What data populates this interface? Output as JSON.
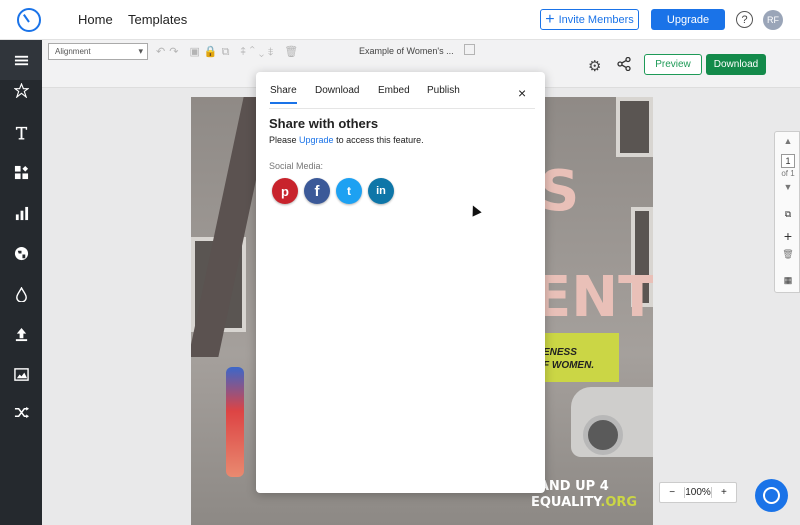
{
  "header": {
    "nav": [
      "Home",
      "Templates"
    ],
    "invite_label": "Invite Members",
    "upgrade_label": "Upgrade",
    "help": "?",
    "avatar_initials": "RF"
  },
  "sidebar": {
    "items": [
      {
        "icon": "menu-icon"
      },
      {
        "icon": "star-icon"
      },
      {
        "icon": "text-icon"
      },
      {
        "icon": "shapes-icon"
      },
      {
        "icon": "chart-icon"
      },
      {
        "icon": "globe-icon"
      },
      {
        "icon": "droplet-icon"
      },
      {
        "icon": "upload-icon"
      },
      {
        "icon": "image-icon"
      },
      {
        "icon": "shuffle-icon"
      }
    ]
  },
  "toolbar": {
    "alignment_select": "Alignment",
    "document_title": "Example of Women's ...",
    "preview_label": "Preview",
    "download_label": "Download"
  },
  "modal": {
    "tabs": [
      "Share",
      "Download",
      "Embed",
      "Publish"
    ],
    "active_tab": "Share",
    "close": "×",
    "title": "Share with others",
    "note_prefix": "Please ",
    "note_link": "Upgrade",
    "note_suffix": " to access this feature.",
    "social_label": "Social Media:",
    "social": [
      {
        "name": "pinterest",
        "glyph": "p",
        "color": "#c8232c"
      },
      {
        "name": "facebook",
        "glyph": "f",
        "color": "#3b5998"
      },
      {
        "name": "twitter",
        "glyph": "t",
        "color": "#1da1f2"
      },
      {
        "name": "linkedin",
        "glyph": "in",
        "color": "#0e76a8"
      }
    ]
  },
  "poster": {
    "big_letter_top": "S",
    "big_word_mid": "ENT",
    "band_line1": "ENESS",
    "band_line2": "F WOMEN.",
    "footer_line1": "TAND UP 4",
    "footer_line2_a": "EQUALITY",
    "footer_line2_b": ".ORG"
  },
  "page_panel": {
    "page_value": "1",
    "page_of": "of 1"
  },
  "zoom": {
    "minus": "−",
    "value": "100%",
    "plus": "+"
  }
}
